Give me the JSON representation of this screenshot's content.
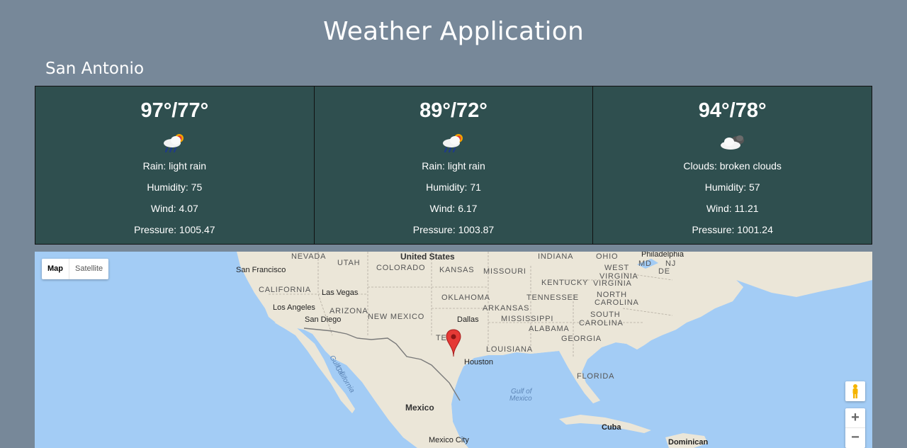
{
  "app": {
    "title": "Weather Application"
  },
  "location": {
    "city": "San Antonio"
  },
  "forecast": [
    {
      "temp": "97°/77°",
      "icon": "rain-sun-icon",
      "condition": "Rain: light rain",
      "humidity": "Humidity: 75",
      "wind": "Wind: 4.07",
      "pressure": "Pressure: 1005.47"
    },
    {
      "temp": "89°/72°",
      "icon": "rain-sun-icon",
      "condition": "Rain: light rain",
      "humidity": "Humidity: 71",
      "wind": "Wind: 6.17",
      "pressure": "Pressure: 1003.87"
    },
    {
      "temp": "94°/78°",
      "icon": "cloud-icon",
      "condition": "Clouds: broken clouds",
      "humidity": "Humidity: 57",
      "wind": "Wind: 11.21",
      "pressure": "Pressure: 1001.24"
    }
  ],
  "map": {
    "type_control": {
      "map": "Map",
      "satellite": "Satellite"
    },
    "zoom": {
      "in": "+",
      "out": "−"
    },
    "labels": {
      "united_states": "United States",
      "nevada": "NEVADA",
      "utah": "UTAH",
      "colorado": "COLORADO",
      "kansas": "KANSAS",
      "missouri": "MISSOURI",
      "indiana": "INDIANA",
      "ohio": "OHIO",
      "philadelphia": "Philadelphia",
      "nj": "NJ",
      "de": "DE",
      "md": "MD",
      "san_francisco": "San Francisco",
      "west_virginia_1": "WEST",
      "west_virginia_2": "VIRGINIA",
      "kentucky": "KENTUCKY",
      "virginia": "VIRGINIA",
      "california": "CALIFORNIA",
      "las_vegas": "Las Vegas",
      "oklahoma": "OKLAHOMA",
      "tennessee": "TENNESSEE",
      "north_carolina_1": "NORTH",
      "north_carolina_2": "CAROLINA",
      "los_angeles": "Los Angeles",
      "arizona": "ARIZONA",
      "new_mexico": "NEW MEXICO",
      "arkansas": "ARKANSAS",
      "south_carolina_1": "SOUTH",
      "south_carolina_2": "CAROLINA",
      "san_diego": "San Diego",
      "dallas": "Dallas",
      "mississippi": "MISSISSIPPI",
      "alabama": "ALABAMA",
      "georgia": "GEORGIA",
      "texas_partial": "TE",
      "louisiana": "LOUISIANA",
      "houston": "Houston",
      "florida": "FLORIDA",
      "gulf_california_1": "Gulf of",
      "gulf_california_2": "California",
      "gulf_mexico_1": "Gulf of",
      "gulf_mexico_2": "Mexico",
      "mexico": "Mexico",
      "cuba": "Cuba",
      "mexico_city": "Mexico City",
      "dominican": "Dominican"
    }
  },
  "colors": {
    "background": "#778899",
    "card": "#2f4f4f",
    "water": "#a3ccf5",
    "land": "#ebe6d8",
    "marker": "#e53935"
  }
}
